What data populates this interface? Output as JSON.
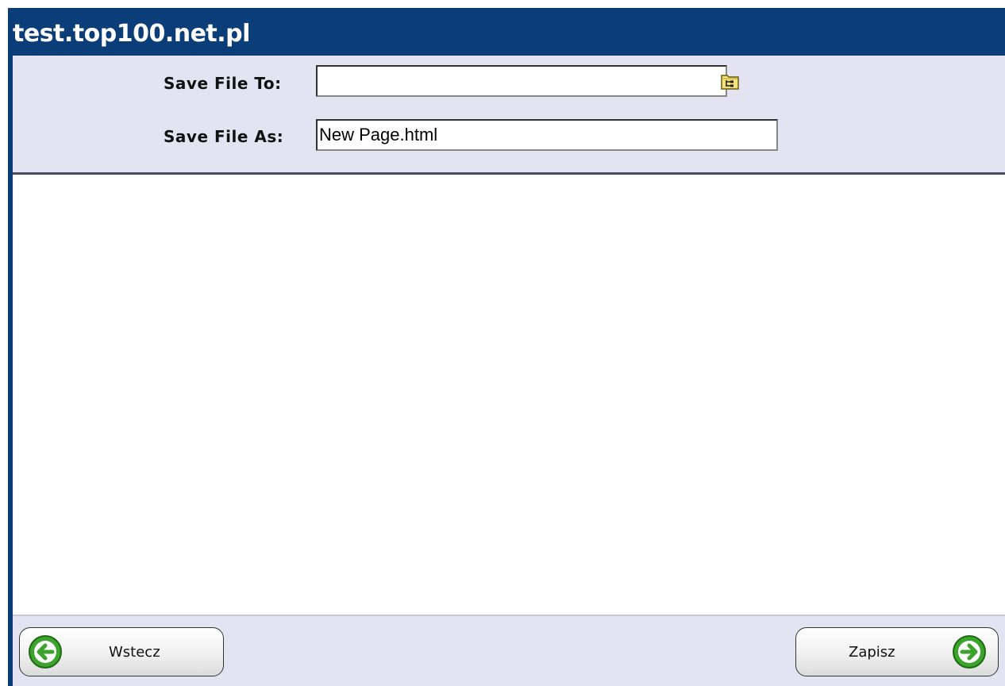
{
  "window": {
    "title": "test.top100.net.pl"
  },
  "form": {
    "save_to_label": "Save File To:",
    "save_to_value": "",
    "save_as_label": "Save File As:",
    "save_as_value": "New Page.html",
    "browse_icon": "folder-tree-icon"
  },
  "footer": {
    "back_label": "Wstecz",
    "back_icon": "arrow-left-icon",
    "save_label": "Zapisz",
    "save_icon": "arrow-right-icon"
  },
  "colors": {
    "titlebar": "#0b3e78",
    "panel": "#e3e3f2",
    "arrow_green": "#3ca32c"
  }
}
